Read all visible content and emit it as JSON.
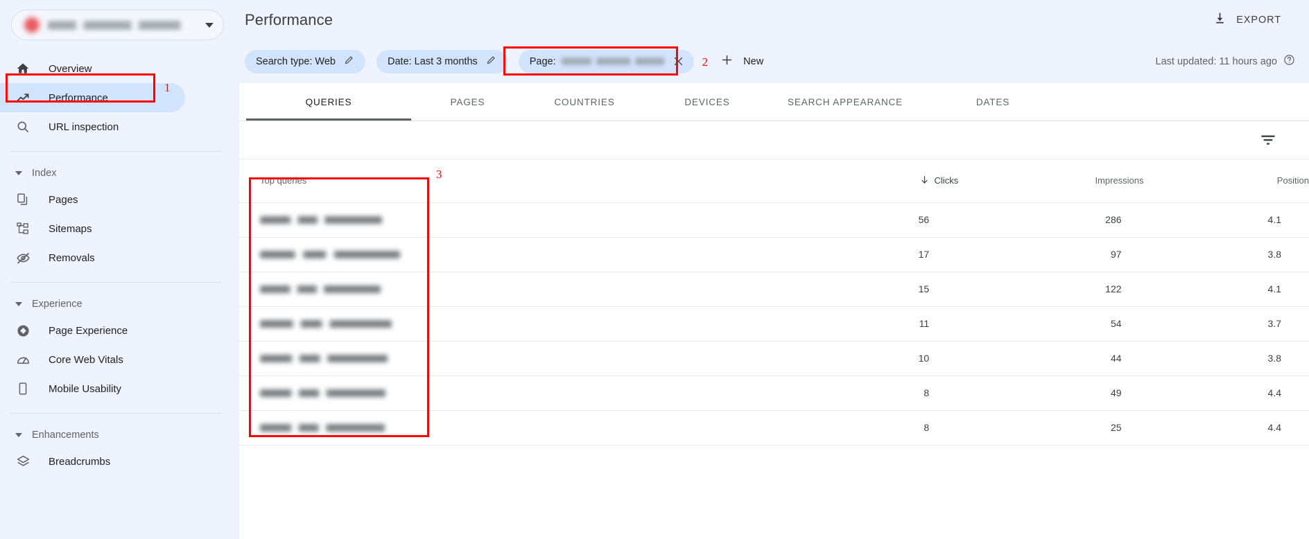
{
  "sidebar": {
    "property": {
      "name": "property-selector",
      "url_redacted": true
    },
    "items": [
      {
        "label": "Overview",
        "icon": "home-icon",
        "active": false
      },
      {
        "label": "Performance",
        "icon": "trending-up-icon",
        "active": true
      },
      {
        "label": "URL inspection",
        "icon": "search-icon",
        "active": false
      }
    ],
    "groups": [
      {
        "label": "Index",
        "items": [
          {
            "label": "Pages",
            "icon": "pages-icon"
          },
          {
            "label": "Sitemaps",
            "icon": "sitemap-icon"
          },
          {
            "label": "Removals",
            "icon": "eye-off-icon"
          }
        ]
      },
      {
        "label": "Experience",
        "items": [
          {
            "label": "Page Experience",
            "icon": "page-experience-icon"
          },
          {
            "label": "Core Web Vitals",
            "icon": "speedometer-icon"
          },
          {
            "label": "Mobile Usability",
            "icon": "mobile-icon"
          }
        ]
      },
      {
        "label": "Enhancements",
        "items": [
          {
            "label": "Breadcrumbs",
            "icon": "layers-icon"
          }
        ]
      }
    ]
  },
  "header": {
    "title": "Performance",
    "export_label": "EXPORT"
  },
  "filters": {
    "search_type": "Search type: Web",
    "date": "Date: Last 3 months",
    "page_prefix": "Page:",
    "page_value_redacted": true,
    "new_label": "New",
    "last_updated": "Last updated: 11 hours ago"
  },
  "tabs": [
    {
      "label": "QUERIES",
      "active": true
    },
    {
      "label": "PAGES",
      "active": false
    },
    {
      "label": "COUNTRIES",
      "active": false
    },
    {
      "label": "DEVICES",
      "active": false
    },
    {
      "label": "SEARCH APPEARANCE",
      "active": false
    },
    {
      "label": "DATES",
      "active": false
    }
  ],
  "table": {
    "columns": {
      "queries": "Top queries",
      "clicks": "Clicks",
      "impressions": "Impressions",
      "position": "Position"
    },
    "sorted_by": "clicks",
    "sort_direction": "desc",
    "rows": [
      {
        "query_redacted": true,
        "query_width": 176,
        "clicks": "56",
        "impressions": "286",
        "position": "4.1"
      },
      {
        "query_redacted": true,
        "query_width": 202,
        "clicks": "17",
        "impressions": "97",
        "position": "3.8"
      },
      {
        "query_redacted": true,
        "query_width": 174,
        "clicks": "15",
        "impressions": "122",
        "position": "4.1"
      },
      {
        "query_redacted": true,
        "query_width": 190,
        "clicks": "11",
        "impressions": "54",
        "position": "3.7"
      },
      {
        "query_redacted": true,
        "query_width": 184,
        "clicks": "10",
        "impressions": "44",
        "position": "3.8"
      },
      {
        "query_redacted": true,
        "query_width": 181,
        "clicks": "8",
        "impressions": "49",
        "position": "4.4"
      },
      {
        "query_redacted": true,
        "query_width": 180,
        "clicks": "8",
        "impressions": "25",
        "position": "4.4"
      }
    ]
  },
  "annotations": [
    {
      "number": "1",
      "target": "performance-nav-item"
    },
    {
      "number": "2",
      "target": "page-filter-chip"
    },
    {
      "number": "3",
      "target": "top-queries-column"
    }
  ],
  "colors": {
    "clicks": "#4285f4",
    "impressions": "#7e57c2",
    "position": "#e8710a",
    "annotation": "#ff0000",
    "active_nav": "#d2e3fc",
    "chip": "#d2e3fc",
    "sidebar_bg": "#eef3fd"
  }
}
